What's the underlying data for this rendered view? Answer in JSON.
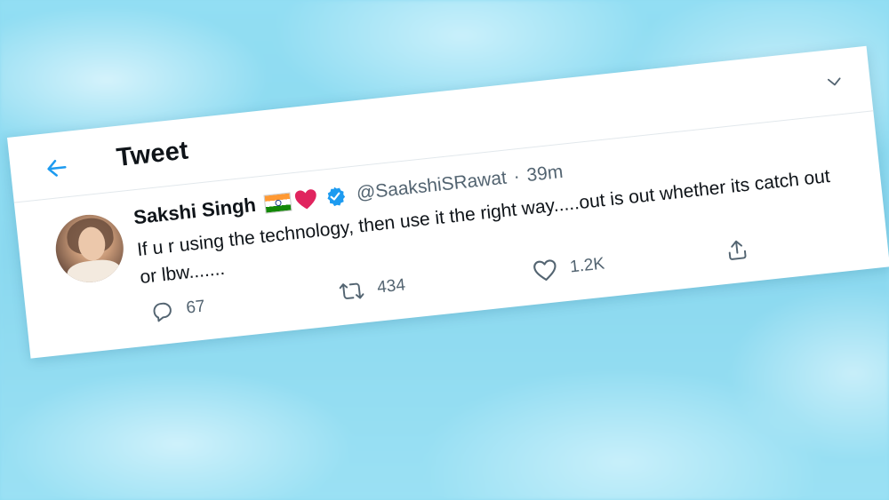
{
  "header": {
    "title": "Tweet"
  },
  "tweet": {
    "display_name": "Sakshi Singh",
    "handle": "@SaakshiSRawat",
    "separator": "·",
    "time": "39m",
    "text": "If u r using the technology, then use it the right way.....out is out whether its catch out or lbw.......",
    "reply_count": "67",
    "retweet_count": "434",
    "like_count": "1.2K"
  },
  "colors": {
    "accent": "#1d9bf0",
    "secondary_text": "#536471",
    "background": "#8fdcf2",
    "heart_emoji": "#e0245e"
  },
  "icons": {
    "back": "arrow-left-icon",
    "more": "chevron-down-icon",
    "reply": "reply-icon",
    "retweet": "retweet-icon",
    "like": "heart-icon",
    "share": "share-icon"
  }
}
